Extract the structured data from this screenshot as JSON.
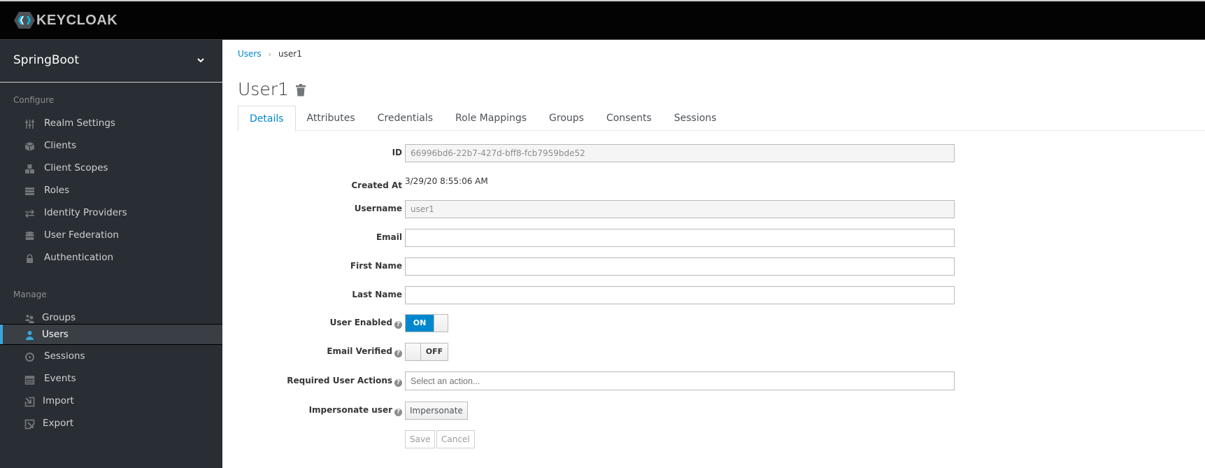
{
  "app": {
    "brand": "KEYCLOAK"
  },
  "sidebar": {
    "realm": "SpringBoot",
    "configure_label": "Configure",
    "manage_label": "Manage",
    "configure_items": [
      {
        "label": "Realm Settings",
        "icon": "sliders-icon"
      },
      {
        "label": "Clients",
        "icon": "cube-icon"
      },
      {
        "label": "Client Scopes",
        "icon": "cubes-icon"
      },
      {
        "label": "Roles",
        "icon": "list-icon"
      },
      {
        "label": "Identity Providers",
        "icon": "exchange-icon"
      },
      {
        "label": "User Federation",
        "icon": "database-icon"
      },
      {
        "label": "Authentication",
        "icon": "lock-icon"
      }
    ],
    "manage_items": [
      {
        "label": "Groups",
        "icon": "users-icon"
      },
      {
        "label": "Users",
        "icon": "user-icon",
        "active": true
      },
      {
        "label": "Sessions",
        "icon": "clock-icon"
      },
      {
        "label": "Events",
        "icon": "calendar-icon"
      },
      {
        "label": "Import",
        "icon": "import-icon"
      },
      {
        "label": "Export",
        "icon": "export-icon"
      }
    ]
  },
  "breadcrumb": {
    "parent": "Users",
    "separator": "›",
    "current": "user1"
  },
  "page": {
    "title": "User1"
  },
  "tabs": [
    "Details",
    "Attributes",
    "Credentials",
    "Role Mappings",
    "Groups",
    "Consents",
    "Sessions"
  ],
  "active_tab": "Details",
  "form": {
    "id_label": "ID",
    "id_value": "66996bd6-22b7-427d-bff8-fcb7959bde52",
    "created_label": "Created At",
    "created_value": "3/29/20 8:55:06 AM",
    "username_label": "Username",
    "username_value": "user1",
    "email_label": "Email",
    "email_value": "",
    "first_name_label": "First Name",
    "first_name_value": "",
    "last_name_label": "Last Name",
    "last_name_value": "",
    "user_enabled_label": "User Enabled",
    "user_enabled_state": "ON",
    "email_verified_label": "Email Verified",
    "email_verified_state": "OFF",
    "required_actions_label": "Required User Actions",
    "required_actions_placeholder": "Select an action...",
    "impersonate_label": "Impersonate user",
    "impersonate_button": "Impersonate",
    "save_button": "Save",
    "cancel_button": "Cancel",
    "help_glyph": "?"
  },
  "colors": {
    "accent": "#0088ce",
    "sidebar_bg": "#292e34",
    "active_indicator": "#39a5dc"
  }
}
